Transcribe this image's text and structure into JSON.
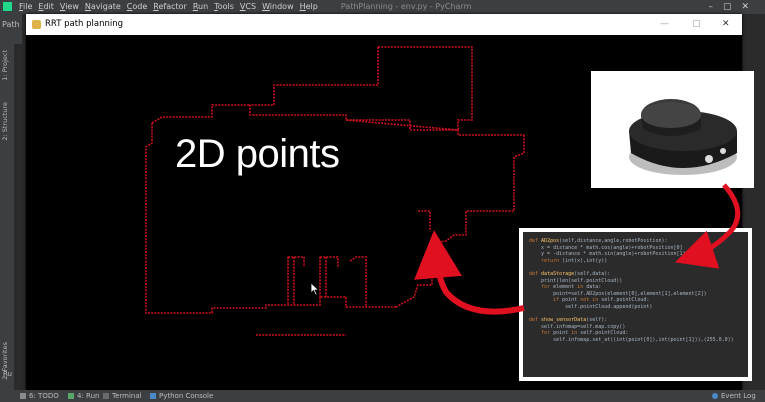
{
  "ide": {
    "menu": [
      "File",
      "Edit",
      "View",
      "Navigate",
      "Code",
      "Refactor",
      "Run",
      "Tools",
      "VCS",
      "Window",
      "Help"
    ],
    "title": "PathPlanning - env.py - PyCharm",
    "path_label": "Path",
    "left_tabs": [
      "1: Project",
      "2: Structure",
      "2: Favorites"
    ],
    "bottom_tabs": [
      "6: TODO",
      "4: Run",
      "Terminal",
      "Python Console"
    ],
    "event_log": "Event Log",
    "run_side": "Ru"
  },
  "window": {
    "title": "RRT path planning"
  },
  "overlay": {
    "label": "2D points"
  },
  "code": {
    "lines": [
      [
        [
          "kw",
          "def "
        ],
        [
          "fn",
          "AD2pos"
        ],
        [
          "",
          "(self,distance,angle,robotPosition):"
        ]
      ],
      [
        [
          "",
          "    x = distance * math.cos(angle)+robotPosition[0]"
        ]
      ],
      [
        [
          "",
          "    y = -distance * math.sin(angle)+robotPosition[1]"
        ]
      ],
      [
        [
          "kw",
          "    return "
        ],
        [
          "",
          "(int(x),int(y))"
        ]
      ],
      [
        [
          "",
          ""
        ]
      ],
      [
        [
          "kw",
          "def "
        ],
        [
          "fn",
          "dataStorage"
        ],
        [
          "",
          "(self,data):"
        ]
      ],
      [
        [
          "",
          "    print(len(self.pointCloud))"
        ]
      ],
      [
        [
          "kw",
          "    for "
        ],
        [
          "",
          "element "
        ],
        [
          "kw",
          "in "
        ],
        [
          "",
          "data:"
        ]
      ],
      [
        [
          "",
          "        point=self.AD2pos(element[0],element[1],element[2])"
        ]
      ],
      [
        [
          "kw",
          "        if "
        ],
        [
          "",
          "point "
        ],
        [
          "kw",
          "not in "
        ],
        [
          "",
          "self.pointCloud:"
        ]
      ],
      [
        [
          "",
          "            self.pointCloud.append(point)"
        ]
      ],
      [
        [
          "",
          ""
        ]
      ],
      [
        [
          "kw",
          "def "
        ],
        [
          "fn",
          "show_sensorData"
        ],
        [
          "",
          "(self):"
        ]
      ],
      [
        [
          "",
          "    self.infomap=self.map.copy()"
        ]
      ],
      [
        [
          "kw",
          "    for "
        ],
        [
          "",
          "point "
        ],
        [
          "kw",
          "in "
        ],
        [
          "",
          "self.pointCloud:"
        ]
      ],
      [
        [
          "",
          "        self.infomap.set_at((int(point[0]),int(point[1])),(255,0,0))"
        ]
      ]
    ]
  },
  "colors": {
    "accent_red": "#e01020",
    "ide_dark": "#3c3f41",
    "code_bg": "#2b2b2b"
  }
}
